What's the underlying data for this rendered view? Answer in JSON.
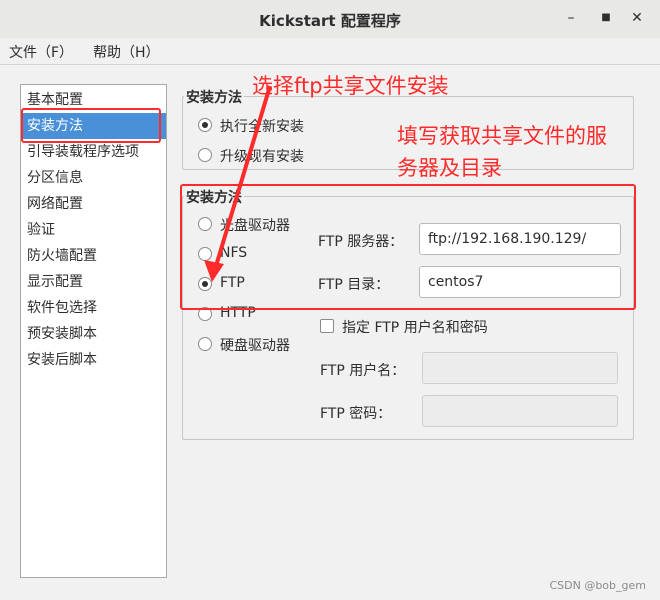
{
  "window": {
    "title": "Kickstart 配置程序",
    "controls": {
      "minimize": "–",
      "maximize": "■",
      "close": "✕"
    }
  },
  "menubar": [
    {
      "label": "文件（F）"
    },
    {
      "label": "帮助（H）"
    }
  ],
  "sidebar": {
    "selected_index": 1,
    "items": [
      {
        "label": "基本配置"
      },
      {
        "label": "安装方法"
      },
      {
        "label": "引导装载程序选项"
      },
      {
        "label": "分区信息"
      },
      {
        "label": "网络配置"
      },
      {
        "label": "验证"
      },
      {
        "label": "防火墙配置"
      },
      {
        "label": "显示配置"
      },
      {
        "label": "软件包选择"
      },
      {
        "label": "预安装脚本"
      },
      {
        "label": "安装后脚本"
      }
    ]
  },
  "install_method": {
    "title": "安装方法",
    "options": [
      {
        "label": "执行全新安装",
        "selected": true
      },
      {
        "label": "升级现有安装",
        "selected": false
      }
    ]
  },
  "install_source": {
    "title": "安装方法",
    "options": [
      {
        "label": "光盘驱动器",
        "selected": false
      },
      {
        "label": "NFS",
        "selected": false
      },
      {
        "label": "FTP",
        "selected": true
      },
      {
        "label": "HTTP",
        "selected": false
      },
      {
        "label": "硬盘驱动器",
        "selected": false
      }
    ],
    "ftp_server_label": "FTP 服务器：",
    "ftp_server_value": "ftp://192.168.190.129/",
    "ftp_dir_label": "FTP 目录：",
    "ftp_dir_value": "centos7",
    "auth_checkbox_label": "指定  FTP 用户名和密码",
    "auth_checked": false,
    "ftp_user_label": "FTP 用户名：",
    "ftp_user_value": "",
    "ftp_pass_label": "FTP 密码：",
    "ftp_pass_value": ""
  },
  "annotations": {
    "select_ftp": "选择ftp共享文件安装",
    "fill_server_line1": "填写获取共享文件的服",
    "fill_server_line2": "务器及目录",
    "color": "#ff2a2a"
  },
  "watermark": "CSDN @bob_gem"
}
